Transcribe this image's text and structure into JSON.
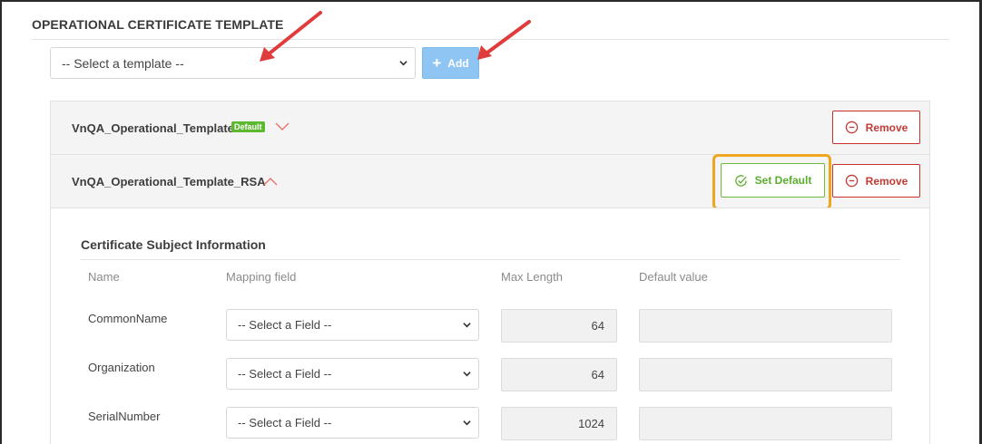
{
  "section": {
    "title": "OPERATIONAL CERTIFICATE TEMPLATE"
  },
  "template_select": {
    "value": "-- Select a template --"
  },
  "add_button": {
    "label": "Add",
    "icon": "plus-icon"
  },
  "templates": [
    {
      "name": "VnQA_Operational_Template",
      "badge": "Default",
      "expanded": false,
      "remove_label": "Remove"
    },
    {
      "name": "VnQA_Operational_Template_RSA",
      "expanded": true,
      "set_default_label": "Set Default",
      "remove_label": "Remove"
    }
  ],
  "subject_info": {
    "title": "Certificate Subject Information",
    "columns": [
      "Name",
      "Mapping field",
      "Max Length",
      "Default value"
    ],
    "rows": [
      {
        "name": "CommonName",
        "mapping": "-- Select a Field --",
        "max_length": "64",
        "default_value": ""
      },
      {
        "name": "Organization",
        "mapping": "-- Select a Field --",
        "max_length": "64",
        "default_value": ""
      },
      {
        "name": "SerialNumber",
        "mapping": "-- Select a Field --",
        "max_length": "1024",
        "default_value": ""
      }
    ]
  },
  "colors": {
    "accent_blue": "#8ec5f2",
    "remove_red": "#c9302c",
    "default_green": "#5cb82e",
    "highlight_orange": "#efa520",
    "annotation_arrow": "#e03c3c"
  }
}
